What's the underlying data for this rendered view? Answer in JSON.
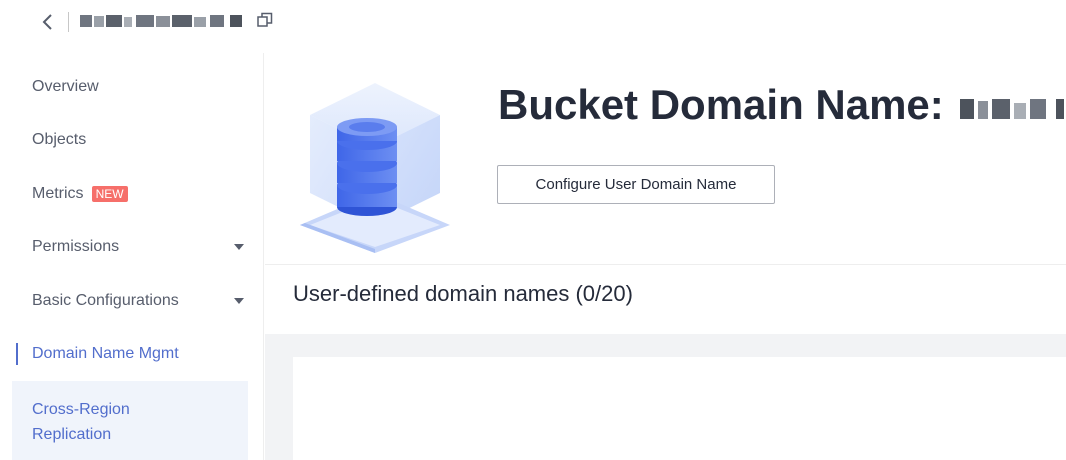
{
  "topbar": {
    "back_icon": "chevron-left-icon",
    "bucket_name": "",
    "copy_icon": "copy-icon"
  },
  "sidebar": {
    "items": [
      {
        "label": "Overview"
      },
      {
        "label": "Objects"
      },
      {
        "label": "Metrics",
        "badge": "NEW"
      },
      {
        "label": "Permissions",
        "icon": "caret-down-icon"
      },
      {
        "label": "Basic Configurations",
        "icon": "caret-down-icon"
      },
      {
        "label": "Domain Name Mgmt",
        "active": true
      },
      {
        "label": "Cross-Region Replication"
      }
    ]
  },
  "header": {
    "illustration_icon": "database-icon",
    "title": "Bucket Domain Name:",
    "configure_button": "Configure User Domain Name"
  },
  "section": {
    "title": "User-defined domain names (0/20)"
  },
  "colors": {
    "accent": "#526ecc",
    "badge": "#f66f6a",
    "text": "#252b3a",
    "muted_text": "#575d6c",
    "content_bg": "#f2f3f5"
  }
}
